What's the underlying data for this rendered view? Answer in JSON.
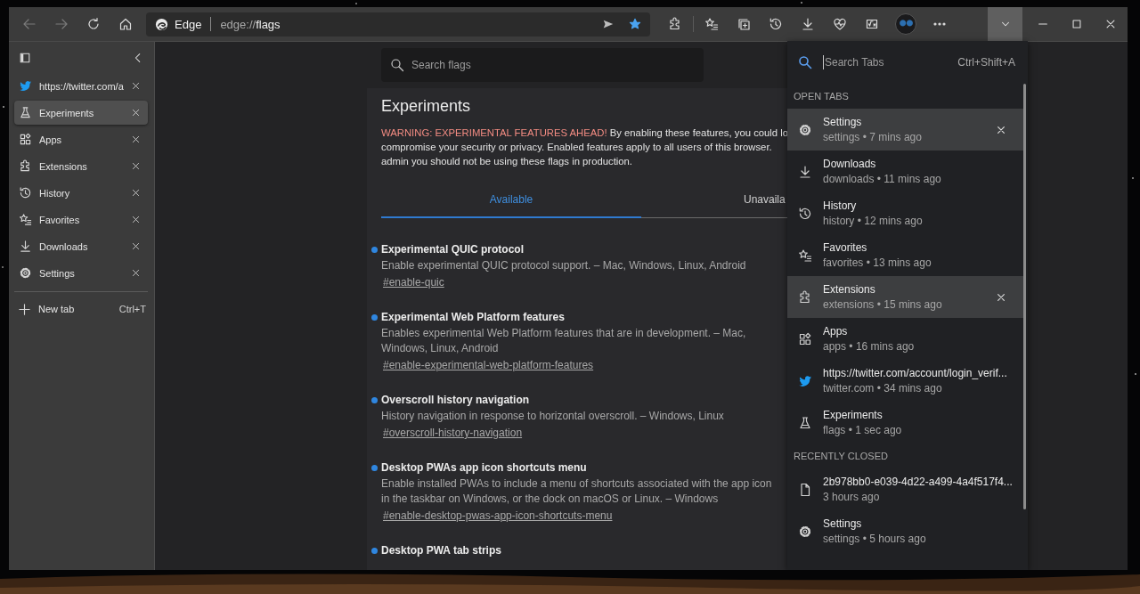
{
  "toolbar": {
    "back": {
      "disabled": true
    },
    "forward": {
      "disabled": true
    },
    "address": {
      "site": "Edge",
      "scheme": "edge://",
      "path": "flags",
      "favorited": true
    }
  },
  "sidebar": {
    "tabs": [
      {
        "kind": "twitter",
        "title": "https://twitter.com/a",
        "selected": false
      },
      {
        "kind": "flags",
        "title": "Experiments",
        "selected": true
      },
      {
        "kind": "apps",
        "title": "Apps",
        "selected": false
      },
      {
        "kind": "extensions",
        "title": "Extensions",
        "selected": false
      },
      {
        "kind": "history",
        "title": "History",
        "selected": false
      },
      {
        "kind": "favorites",
        "title": "Favorites",
        "selected": false
      },
      {
        "kind": "downloads",
        "title": "Downloads",
        "selected": false
      },
      {
        "kind": "settings",
        "title": "Settings",
        "selected": false
      }
    ],
    "new_tab": {
      "label": "New tab",
      "shortcut": "Ctrl+T"
    }
  },
  "flags_page": {
    "search": {
      "placeholder": "Search flags"
    },
    "title": "Experiments",
    "warning": {
      "alert": "WARNING: EXPERIMENTAL FEATURES AHEAD!",
      "lines": [
        "By enabling these features, you could lo",
        "compromise your security or privacy. Enabled features apply to all users of this browser.",
        "admin you should not be using these flags in production."
      ]
    },
    "tabs": [
      {
        "label": "Available",
        "selected": true
      },
      {
        "label": "Unavaila",
        "selected": false
      }
    ],
    "flags": [
      {
        "name": "Experimental QUIC protocol",
        "description": "Enable experimental QUIC protocol support. – Mac, Windows, Linux, Android",
        "link": "#enable-quic"
      },
      {
        "name": "Experimental Web Platform features",
        "description": "Enables experimental Web Platform features that are in development. – Mac, Windows, Linux, Android",
        "link": "#enable-experimental-web-platform-features"
      },
      {
        "name": "Overscroll history navigation",
        "description": "History navigation in response to horizontal overscroll. – Windows, Linux",
        "link": "#overscroll-history-navigation"
      },
      {
        "name": "Desktop PWAs app icon shortcuts menu",
        "description": "Enable installed PWAs to include a menu of shortcuts associated with the app icon in the taskbar on Windows, or the dock on macOS or Linux. – Windows",
        "link": "#enable-desktop-pwas-app-icon-shortcuts-menu"
      },
      {
        "name": "Desktop PWA tab strips"
      }
    ]
  },
  "tab_menu": {
    "search": {
      "placeholder": "Search Tabs"
    },
    "shortcut": "Ctrl+Shift+A",
    "sections": [
      {
        "heading": "OPEN TABS",
        "items": [
          {
            "kind": "settings",
            "title": "Settings",
            "subtitle": "settings • 7 mins ago",
            "highlighted": true
          },
          {
            "kind": "downloads",
            "title": "Downloads",
            "subtitle": "downloads • 11 mins ago",
            "highlighted": false
          },
          {
            "kind": "history",
            "title": "History",
            "subtitle": "history • 12 mins ago",
            "highlighted": false
          },
          {
            "kind": "favorites",
            "title": "Favorites",
            "subtitle": "favorites • 13 mins ago",
            "highlighted": false
          },
          {
            "kind": "extensions",
            "title": "Extensions",
            "subtitle": "extensions • 15 mins ago",
            "highlighted": true
          },
          {
            "kind": "apps",
            "title": "Apps",
            "subtitle": "apps • 16 mins ago",
            "highlighted": false
          },
          {
            "kind": "twitter",
            "title": "https://twitter.com/account/login_verif...",
            "subtitle": "twitter.com • 34 mins ago",
            "highlighted": false
          },
          {
            "kind": "flags",
            "title": "Experiments",
            "subtitle": "flags • 1 sec ago",
            "highlighted": false
          }
        ]
      },
      {
        "heading": "RECENTLY CLOSED",
        "items": [
          {
            "kind": "file",
            "title": "2b978bb0-e039-4d22-a499-4a4f517f4...",
            "subtitle": "3 hours ago",
            "highlighted": false
          },
          {
            "kind": "settings",
            "title": "Settings",
            "subtitle": "settings • 5 hours ago",
            "highlighted": false
          }
        ]
      }
    ]
  }
}
